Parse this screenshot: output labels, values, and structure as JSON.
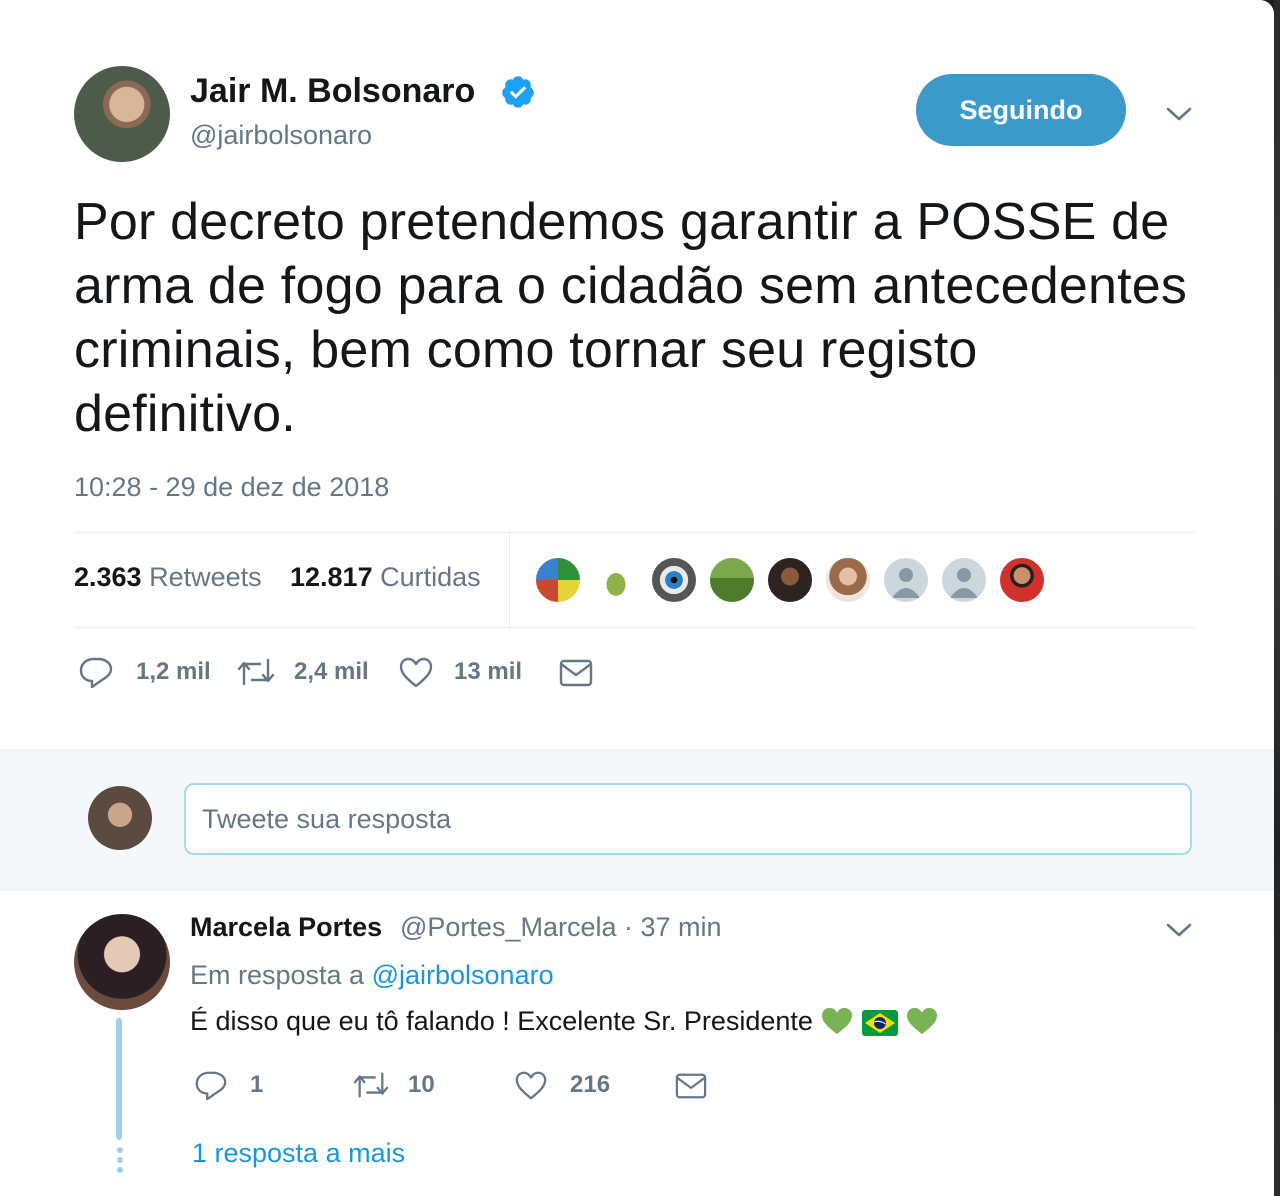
{
  "tweet": {
    "author_name": "Jair M. Bolsonaro",
    "author_handle": "@jairbolsonaro",
    "verified_icon": "verified-badge-icon",
    "follow_button": "Seguindo",
    "text": "Por decreto pretendemos garantir a POSSE de arma de fogo para o cidadão sem antecedentes criminais, bem como tornar seu registo definitivo.",
    "timestamp": "10:28 - 29 de dez de 2018",
    "retweets_count": "2.363",
    "retweets_label": "Retweets",
    "likes_count": "12.817",
    "likes_label": "Curtidas",
    "actions": {
      "reply": "1,2 mil",
      "retweet": "2,4 mil",
      "like": "13 mil"
    }
  },
  "reply_box": {
    "placeholder": "Tweete sua resposta"
  },
  "reply": {
    "author_name": "Marcela Portes",
    "author_handle": "@Portes_Marcela",
    "time": "· 37 min",
    "in_reply_prefix": "Em resposta a",
    "in_reply_handle": "@jairbolsonaro",
    "text": "É disso que eu tô falando ! Excelente Sr. Presidente",
    "actions": {
      "reply": "1",
      "retweet": "10",
      "like": "216"
    },
    "more_replies": "1 resposta a mais"
  },
  "colors": {
    "accent": "#1b95e0",
    "follow_button": "#3b9ac9",
    "muted_text": "#657786",
    "primary_text": "#14171a",
    "heart_emoji": "#77b255"
  }
}
